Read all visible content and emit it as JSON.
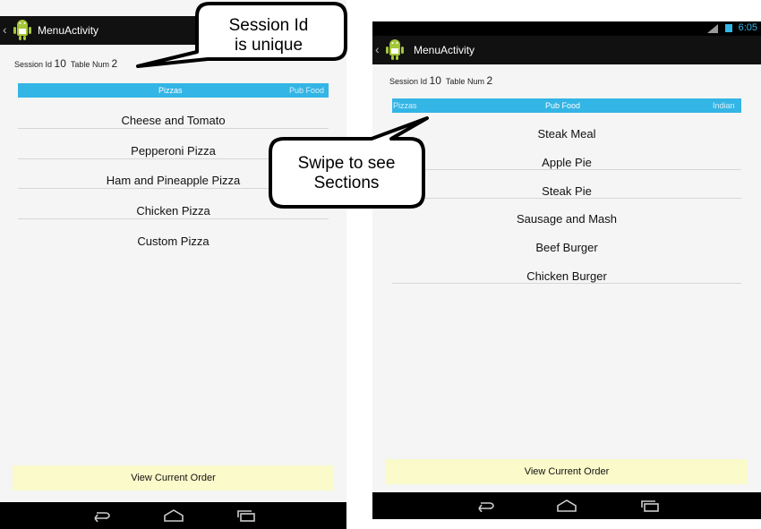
{
  "left": {
    "title": "MenuActivity",
    "session_label": "Session Id",
    "session_value": "10",
    "table_label": "Table Num",
    "table_value": "2",
    "tabs": [
      "Pizzas",
      "Pub Food"
    ],
    "items": [
      "Cheese and Tomato",
      "Pepperoni Pizza",
      "Ham and Pineapple Pizza",
      "Chicken Pizza",
      "Custom Pizza"
    ],
    "order_button": "View Current Order"
  },
  "right": {
    "time": "6:05",
    "title": "MenuActivity",
    "session_label": "Session Id",
    "session_value": "10",
    "table_label": "Table Num",
    "table_value": "2",
    "tabs": [
      "Pizzas",
      "Pub Food",
      "Indian"
    ],
    "items": [
      "Steak Meal",
      "Apple Pie",
      "Steak Pie",
      "Sausage and Mash",
      "Beef Burger",
      "Chicken Burger"
    ],
    "order_button": "View Current Order"
  },
  "callouts": {
    "session_line1": "Session Id",
    "session_line2": "is unique",
    "swipe_line1": "Swipe to see",
    "swipe_line2": "Sections"
  },
  "icons": [
    "back-chevron-icon",
    "android-logo-icon",
    "back-nav-icon",
    "home-nav-icon",
    "recents-nav-icon",
    "wifi-signal-icon",
    "battery-icon"
  ],
  "colors": {
    "accent": "#33b5e5",
    "order_button_bg": "#fafaca",
    "bar_bg": "#111111"
  }
}
